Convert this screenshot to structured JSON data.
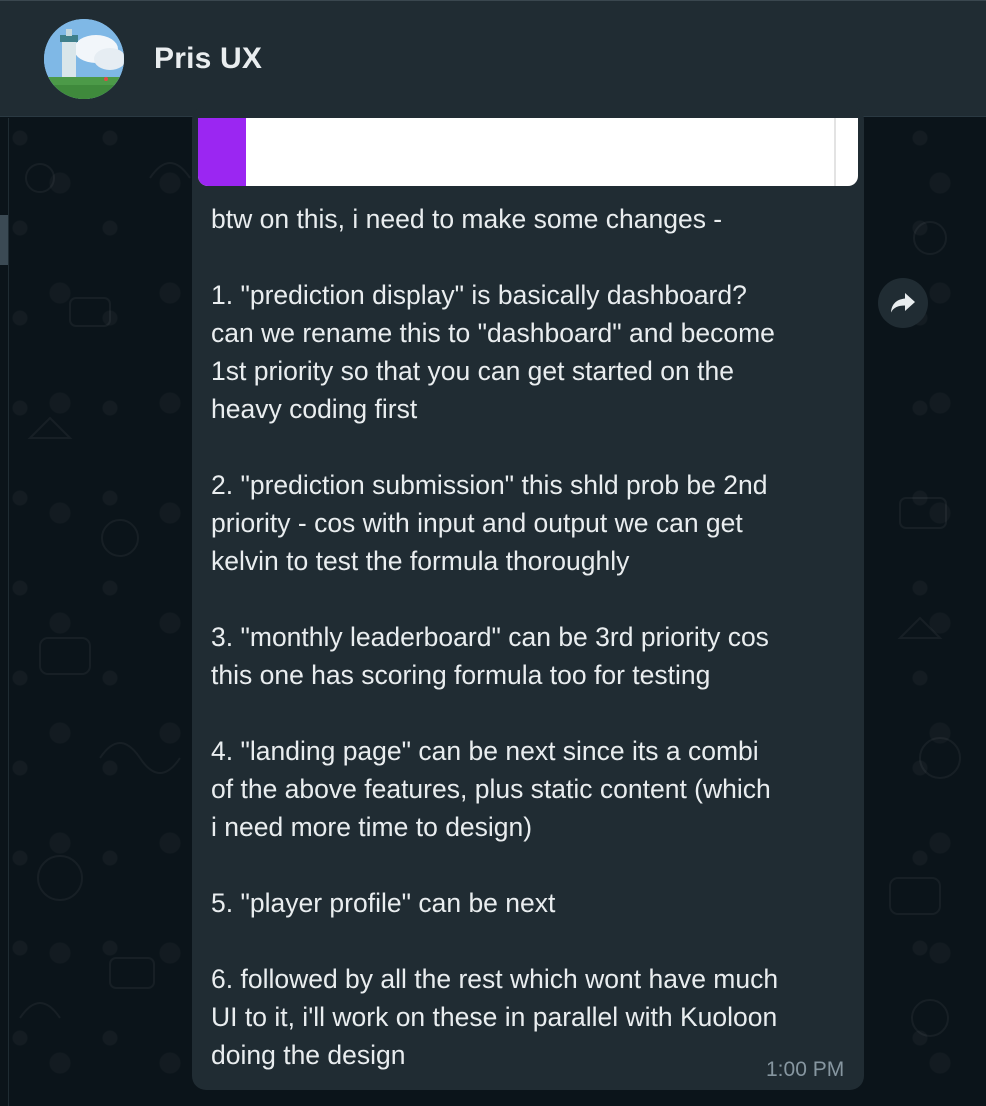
{
  "header": {
    "contact_name": "Pris UX",
    "avatar_icon": "landscape-lighthouse-avatar-icon"
  },
  "message": {
    "lines": [
      "btw on this, i need to make some changes -",
      "",
      "1. \"prediction display\" is basically dashboard?",
      "can we rename this to \"dashboard\" and become",
      "1st priority so that you can get started on the",
      "heavy coding first",
      "",
      "2. \"prediction submission\" this shld prob be 2nd",
      "priority - cos with input and output we can get",
      "kelvin to test the formula thoroughly",
      "",
      "3. \"monthly leaderboard\" can be 3rd priority cos",
      "this one has scoring formula too for testing",
      "",
      "4. \"landing page\" can be next since its a combi",
      "of the above features, plus static content (which",
      "i need more time to design)",
      "",
      "5. \"player profile\" can be next",
      "",
      "6. followed by all the rest which wont have much",
      "UI to it, i'll work on these in parallel with Kuoloon",
      "doing the design"
    ],
    "timestamp": "1:00 PM",
    "media_accent_color": "#9b26f2"
  },
  "forward": {
    "icon": "forward-arrow-icon"
  },
  "colors": {
    "header_bg": "#202c33",
    "chat_bg": "#0b141a",
    "bubble_bg": "#202c33",
    "text": "#e9edef",
    "meta_text": "#8696a0"
  }
}
